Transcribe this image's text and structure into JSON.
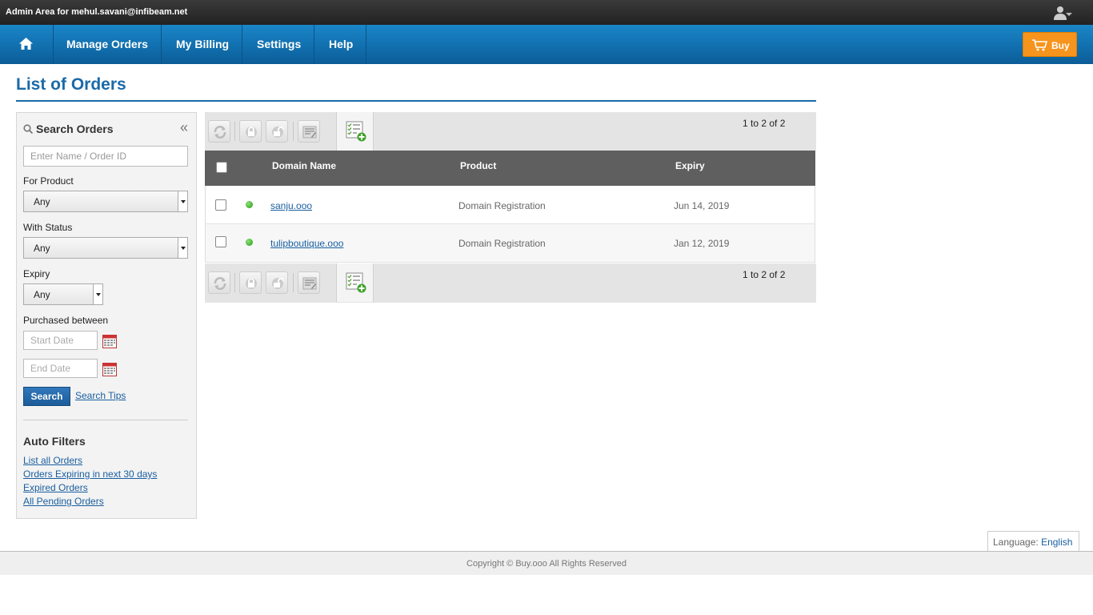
{
  "topbar": {
    "admin_text": "Admin Area for mehul.savani@infibeam.net",
    "user_icon": "user-icon"
  },
  "nav": {
    "home_icon": "home-icon",
    "items": [
      "Manage Orders",
      "My Billing",
      "Settings",
      "Help"
    ],
    "buy_label": "Buy"
  },
  "page_title": "List of Orders",
  "sidebar": {
    "title": "Search Orders",
    "collapse_glyph": "«",
    "name_placeholder": "Enter Name / Order ID",
    "product_label": "For Product",
    "product_value": "Any",
    "status_label": "With Status",
    "status_value": "Any",
    "expiry_label": "Expiry",
    "expiry_value": "Any",
    "purchased_label": "Purchased between",
    "start_placeholder": "Start Date",
    "end_placeholder": "End Date",
    "search_label": "Search",
    "tips_label": "Search Tips",
    "auto_filters_title": "Auto Filters",
    "auto_filters": [
      "List all Orders",
      "Orders Expiring in next 30 days",
      "Expired Orders",
      "All Pending Orders"
    ]
  },
  "table": {
    "pager": "1 to 2 of 2",
    "columns": [
      "Domain Name",
      "Product",
      "Expiry"
    ],
    "rows": [
      {
        "domain": "sanju.ooo",
        "product": "Domain Registration",
        "expiry": "Jun 14, 2019",
        "status": "active"
      },
      {
        "domain": "tulipboutique.ooo",
        "product": "Domain Registration",
        "expiry": "Jan 12, 2019",
        "status": "active"
      }
    ]
  },
  "language": {
    "label": "Language:",
    "value": "English"
  },
  "footer": {
    "copyright": "Copyright © Buy.ooo All Rights Reserved"
  },
  "colors": {
    "nav_blue": "#0b6fb3",
    "buy_orange": "#f7941d",
    "title_blue": "#1a6aa8",
    "status_green": "#2aa81a"
  }
}
